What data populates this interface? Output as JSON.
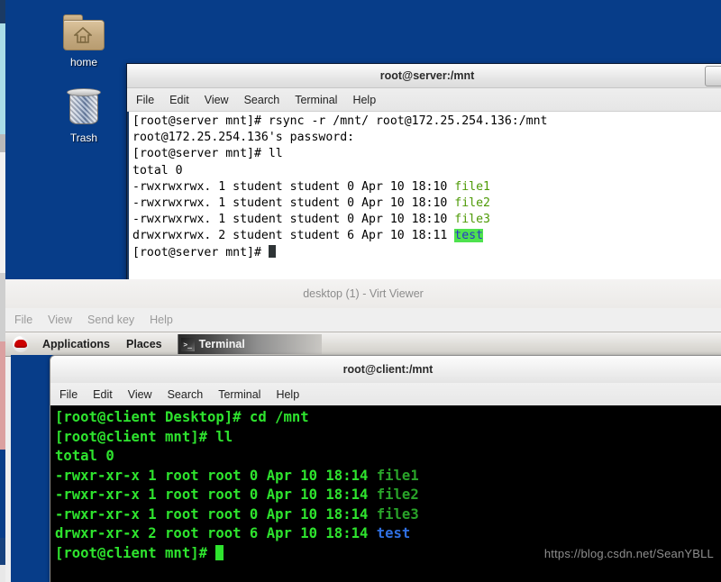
{
  "desktop": {
    "background_color": "#073d89",
    "icons": [
      {
        "name": "home",
        "label": "home"
      },
      {
        "name": "trash",
        "label": "Trash"
      }
    ]
  },
  "terminal_server": {
    "title": "root@server:/mnt",
    "menu": [
      "File",
      "Edit",
      "View",
      "Search",
      "Terminal",
      "Help"
    ],
    "lines": [
      {
        "segments": [
          {
            "text": "[root@server mnt]# rsync -r /mnt/ root@172.25.254.136:/mnt",
            "style": "plain"
          }
        ]
      },
      {
        "segments": [
          {
            "text": "root@172.25.254.136's password:",
            "style": "plain"
          }
        ]
      },
      {
        "segments": [
          {
            "text": "[root@server mnt]# ll",
            "style": "plain"
          }
        ]
      },
      {
        "segments": [
          {
            "text": "total 0",
            "style": "plain"
          }
        ]
      },
      {
        "segments": [
          {
            "text": "-rwxrwxrwx. 1 student student 0 Apr 10 18:10 ",
            "style": "plain"
          },
          {
            "text": "file1",
            "style": "file"
          }
        ]
      },
      {
        "segments": [
          {
            "text": "-rwxrwxrwx. 1 student student 0 Apr 10 18:10 ",
            "style": "plain"
          },
          {
            "text": "file2",
            "style": "file"
          }
        ]
      },
      {
        "segments": [
          {
            "text": "-rwxrwxrwx. 1 student student 0 Apr 10 18:10 ",
            "style": "plain"
          },
          {
            "text": "file3",
            "style": "file"
          }
        ]
      },
      {
        "segments": [
          {
            "text": "drwxrwxrwx. 2 student student 6 Apr 10 18:11 ",
            "style": "plain"
          },
          {
            "text": "test",
            "style": "dir"
          }
        ]
      },
      {
        "segments": [
          {
            "text": "[root@server mnt]# ",
            "style": "plain"
          },
          {
            "text": "",
            "style": "cursor"
          }
        ]
      }
    ]
  },
  "virt_viewer": {
    "title": "desktop (1) - Virt Viewer",
    "menu": [
      "File",
      "View",
      "Send key",
      "Help"
    ]
  },
  "gnome_panel": {
    "logo": "redhat-logo",
    "applications_label": "Applications",
    "places_label": "Places",
    "task_label": "Terminal",
    "task_icon_glyph": ">_"
  },
  "terminal_client": {
    "title": "root@client:/mnt",
    "menu": [
      "File",
      "Edit",
      "View",
      "Search",
      "Terminal",
      "Help"
    ],
    "lines": [
      {
        "segments": [
          {
            "text": "[root@client Desktop]# cd /mnt",
            "style": "plain"
          }
        ]
      },
      {
        "segments": [
          {
            "text": "[root@client mnt]# ll",
            "style": "plain"
          }
        ]
      },
      {
        "segments": [
          {
            "text": "total 0",
            "style": "plain"
          }
        ]
      },
      {
        "segments": [
          {
            "text": "-rwxr-xr-x 1 root root 0 Apr 10 18:14 ",
            "style": "plain"
          },
          {
            "text": "file1",
            "style": "file"
          }
        ]
      },
      {
        "segments": [
          {
            "text": "-rwxr-xr-x 1 root root 0 Apr 10 18:14 ",
            "style": "plain"
          },
          {
            "text": "file2",
            "style": "file"
          }
        ]
      },
      {
        "segments": [
          {
            "text": "-rwxr-xr-x 1 root root 0 Apr 10 18:14 ",
            "style": "plain"
          },
          {
            "text": "file3",
            "style": "file"
          }
        ]
      },
      {
        "segments": [
          {
            "text": "drwxr-xr-x 2 root root 6 Apr 10 18:14 ",
            "style": "plain"
          },
          {
            "text": "test",
            "style": "dir"
          }
        ]
      },
      {
        "segments": [
          {
            "text": "[root@client mnt]# ",
            "style": "plain"
          },
          {
            "text": "",
            "style": "cursor"
          }
        ]
      }
    ]
  },
  "watermark": {
    "text": "https://blog.csdn.net/SeanYBLL"
  },
  "colors": {
    "desktop_blue": "#073d89",
    "light_term_bg": "#ffffff",
    "dark_term_bg": "#000000",
    "green_file": "#4e9a06",
    "dir_highlight_bg": "#4ee24e",
    "dir_fg": "#2a37c8",
    "client_green": "#2ee32e",
    "client_file_green": "#29a329",
    "client_dir_blue": "#2f6fe0"
  }
}
